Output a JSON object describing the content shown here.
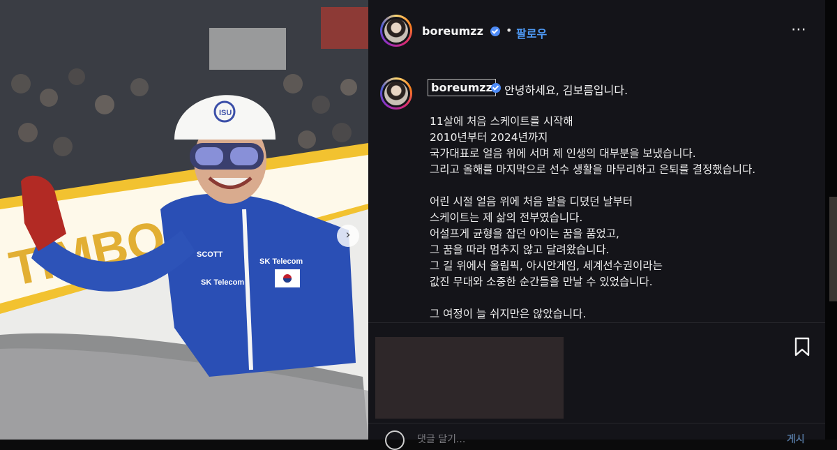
{
  "post": {
    "username": "boreumzz",
    "dot": "•",
    "follow_label": "팔로우",
    "more_icon": "more-horizontal-icon",
    "next_icon": "chevron-right-icon"
  },
  "caption": {
    "username": "boreumzz",
    "greeting": "안녕하세요, 김보름입니다.",
    "lines": [
      "11살에 처음 스케이트를 시작해",
      "2010년부터 2024년까지",
      "국가대표로 얼음 위에 서며 제 인생의 대부분을 보냈습니다.",
      "그리고 올해를 마지막으로 선수 생활을 마무리하고 은퇴를 결정했습니다.",
      "",
      "어린 시절 얼음 위에 처음 발을 디뎠던 날부터",
      "스케이트는 제 삶의 전부였습니다.",
      "어설프게 균형을 잡던 아이는 꿈을 품었고,",
      "그 꿈을 따라 멈추지 않고 달려왔습니다.",
      "그 길 위에서 올림픽, 아시안게임, 세계선수권이라는",
      "값진 무대와 소중한 순간들을 만날 수 있었습니다.",
      "",
      "그 여정이 늘 쉬지만은 않았습니다."
    ]
  },
  "photo": {
    "helmet_logo": "ISU",
    "sponsor_1": "SCOTT",
    "sponsor_2": "SK Telecom",
    "sponsor_3": "SK Telecom"
  },
  "comment": {
    "placeholder": "댓글 달기...",
    "post_label": "게시"
  },
  "colors": {
    "accent": "#4f9bf7",
    "background": "#141419",
    "suit": "#2a4fb5"
  }
}
